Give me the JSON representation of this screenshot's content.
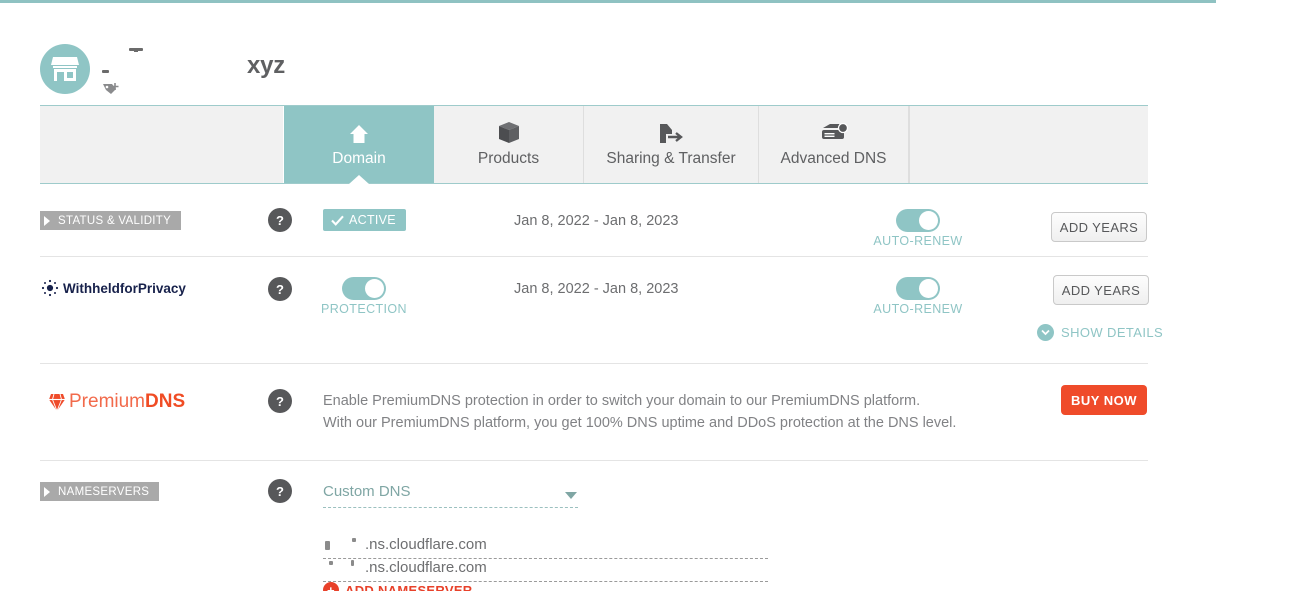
{
  "header": {
    "avatar_icon": "storefront-icon",
    "domain_name": "xyz",
    "tag_icon": "tag-plus-icon"
  },
  "tabs": [
    {
      "label": "Domain",
      "icon": "home-icon",
      "active": true
    },
    {
      "label": "Products",
      "icon": "box-icon",
      "active": false
    },
    {
      "label": "Sharing & Transfer",
      "icon": "transfer-icon",
      "active": false
    },
    {
      "label": "Advanced DNS",
      "icon": "server-icon",
      "active": false
    }
  ],
  "status_row": {
    "ribbon_label": "STATUS & VALIDITY",
    "help_label": "?",
    "status_badge": "ACTIVE",
    "date_range": "Jan 8, 2022 - Jan 8, 2023",
    "toggle_label": "AUTO-RENEW",
    "toggle_state": "on",
    "add_years_label": "ADD YEARS"
  },
  "privacy_row": {
    "brand_a": "Withheldfor",
    "brand_b": "Privacy",
    "help_label": "?",
    "toggle_label": "PROTECTION",
    "toggle_state": "on",
    "date_range": "Jan 8, 2022 - Jan 8, 2023",
    "auto_renew_label": "AUTO-RENEW",
    "auto_renew_state": "on",
    "add_years_label": "ADD YEARS",
    "show_details_label": "SHOW DETAILS"
  },
  "premium_dns_row": {
    "brand_a": "Premium",
    "brand_b": "DNS",
    "help_label": "?",
    "description_line1": "Enable PremiumDNS protection in order to switch your domain to our PremiumDNS platform.",
    "description_line2": "With our PremiumDNS platform, you get 100% DNS uptime and DDoS protection at the DNS level.",
    "buy_now_label": "BUY NOW"
  },
  "nameservers_row": {
    "ribbon_label": "NAMESERVERS",
    "help_label": "?",
    "dns_type_selected": "Custom DNS",
    "nameserver_1": ".ns.cloudflare.com",
    "nameserver_2": ".ns.cloudflare.com",
    "add_nameserver_label": "ADD NAMESERVER"
  },
  "colors": {
    "teal": "#8fc5c5",
    "teal_border": "#9ecbcb",
    "grey_ribbon": "#a9a9a9",
    "help_circle": "#57585a",
    "orange": "#f04c24",
    "red_button": "#ef4b2a",
    "text_grey": "#6d6e70",
    "navy": "#17214b"
  }
}
